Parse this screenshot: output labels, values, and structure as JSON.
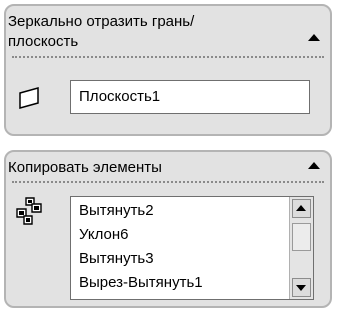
{
  "mirror_panel": {
    "title": "Зеркально отразить грань/плоскость",
    "face_field_value": "Плоскость1",
    "icon": "face-plane-icon",
    "collapse_icon": "chevron-up-icon"
  },
  "copy_panel": {
    "title": "Копировать элементы",
    "icon": "copy-features-icon",
    "collapse_icon": "chevron-up-icon",
    "items": [
      {
        "label": "Вытянуть2"
      },
      {
        "label": "Уклон6"
      },
      {
        "label": "Вытянуть3"
      },
      {
        "label": "Вырез-Вытянуть1"
      }
    ]
  },
  "colors": {
    "panel_background": "#e2e2e2",
    "panel_border": "#b4b4b4",
    "field_background": "#ffffff"
  }
}
